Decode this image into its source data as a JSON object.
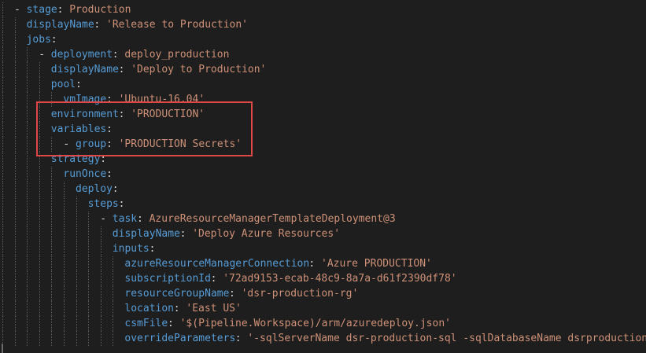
{
  "colors": {
    "background": "#1e1e1e",
    "key": "#569cd6",
    "string": "#ce9178",
    "highlight_border": "#e04848"
  },
  "lines": [
    {
      "indent": 0,
      "dash": true,
      "key": "stage",
      "value": "Production",
      "quoted": false
    },
    {
      "indent": 1,
      "dash": false,
      "key": "displayName",
      "value": "'Release to Production'",
      "quoted": true
    },
    {
      "indent": 1,
      "dash": false,
      "key": "jobs",
      "value": "",
      "quoted": false
    },
    {
      "indent": 2,
      "dash": true,
      "key": "deployment",
      "value": "deploy_production",
      "quoted": false
    },
    {
      "indent": 3,
      "dash": false,
      "key": "displayName",
      "value": "'Deploy to Production'",
      "quoted": true
    },
    {
      "indent": 3,
      "dash": false,
      "key": "pool",
      "value": "",
      "quoted": false
    },
    {
      "indent": 4,
      "dash": false,
      "key": "vmImage",
      "value": "'Ubuntu-16.04'",
      "quoted": true
    },
    {
      "indent": 3,
      "dash": false,
      "key": "environment",
      "value": "'PRODUCTION'",
      "quoted": true
    },
    {
      "indent": 3,
      "dash": false,
      "key": "variables",
      "value": "",
      "quoted": false
    },
    {
      "indent": 4,
      "dash": true,
      "key": "group",
      "value": "'PRODUCTION Secrets'",
      "quoted": true
    },
    {
      "indent": 3,
      "dash": false,
      "key": "strategy",
      "value": "",
      "quoted": false
    },
    {
      "indent": 4,
      "dash": false,
      "key": "runOnce",
      "value": "",
      "quoted": false
    },
    {
      "indent": 5,
      "dash": false,
      "key": "deploy",
      "value": "",
      "quoted": false
    },
    {
      "indent": 6,
      "dash": false,
      "key": "steps",
      "value": "",
      "quoted": false
    },
    {
      "indent": 7,
      "dash": true,
      "key": "task",
      "value": "AzureResourceManagerTemplateDeployment@3",
      "quoted": false
    },
    {
      "indent": 8,
      "dash": false,
      "key": "displayName",
      "value": "'Deploy Azure Resources'",
      "quoted": true
    },
    {
      "indent": 8,
      "dash": false,
      "key": "inputs",
      "value": "",
      "quoted": false
    },
    {
      "indent": 9,
      "dash": false,
      "key": "azureResourceManagerConnection",
      "value": "'Azure PRODUCTION'",
      "quoted": true
    },
    {
      "indent": 9,
      "dash": false,
      "key": "subscriptionId",
      "value": "'72ad9153-ecab-48c9-8a7a-d61f2390df78'",
      "quoted": true
    },
    {
      "indent": 9,
      "dash": false,
      "key": "resourceGroupName",
      "value": "'dsr-production-rg'",
      "quoted": true
    },
    {
      "indent": 9,
      "dash": false,
      "key": "location",
      "value": "'East US'",
      "quoted": true
    },
    {
      "indent": 9,
      "dash": false,
      "key": "csmFile",
      "value": "'$(Pipeline.Workspace)/arm/azuredeploy.json'",
      "quoted": true
    },
    {
      "indent": 9,
      "dash": false,
      "key": "overrideParameters",
      "value": "'-sqlServerName dsr-production-sql -sqlDatabaseName dsrproductiondb",
      "quoted": true
    }
  ]
}
